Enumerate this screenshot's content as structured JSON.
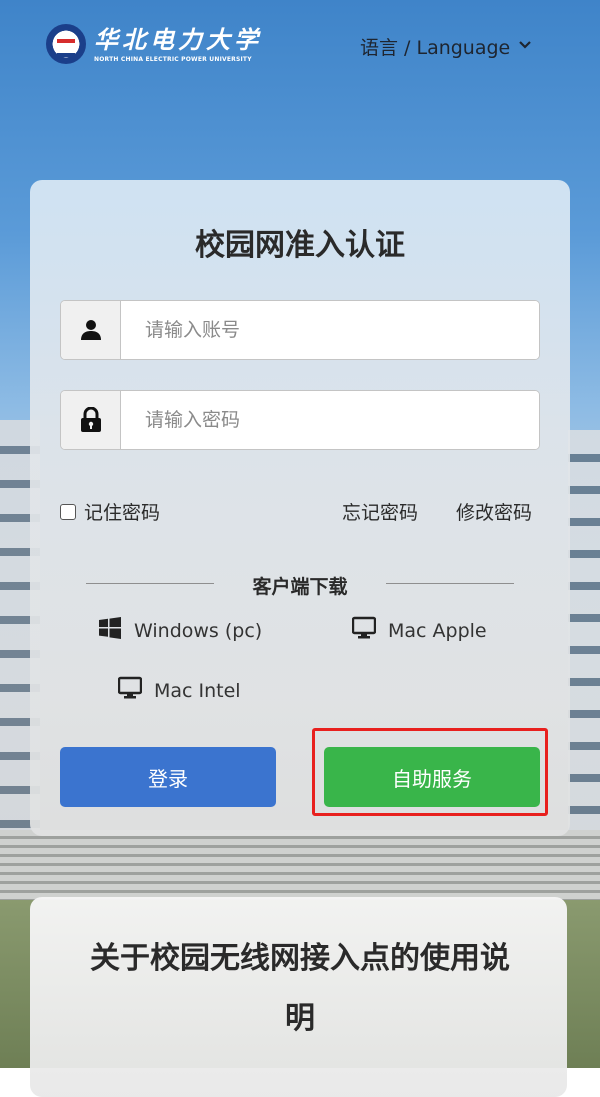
{
  "header": {
    "logo_cn": "华北电力大学",
    "logo_en": "NORTH CHINA ELECTRIC POWER UNIVERSITY",
    "language_label": "语言 / Language"
  },
  "login": {
    "title": "校园网准入认证",
    "account_placeholder": "请输入账号",
    "password_placeholder": "请输入密码",
    "remember_label": "记住密码",
    "forgot_label": "忘记密码",
    "change_label": "修改密码",
    "download_title": "客户端下载",
    "downloads": [
      {
        "label": "Windows (pc)",
        "icon": "windows-icon"
      },
      {
        "label": "Mac Apple",
        "icon": "monitor-icon"
      },
      {
        "label": "Mac Intel",
        "icon": "monitor-icon"
      }
    ],
    "login_button": "登录",
    "self_service_button": "自助服务"
  },
  "notice": {
    "title": "关于校园无线网接入点的使用说明"
  },
  "colors": {
    "login_button": "#3b74cf",
    "self_service_button": "#39b54a",
    "highlight": "#e8201e"
  }
}
